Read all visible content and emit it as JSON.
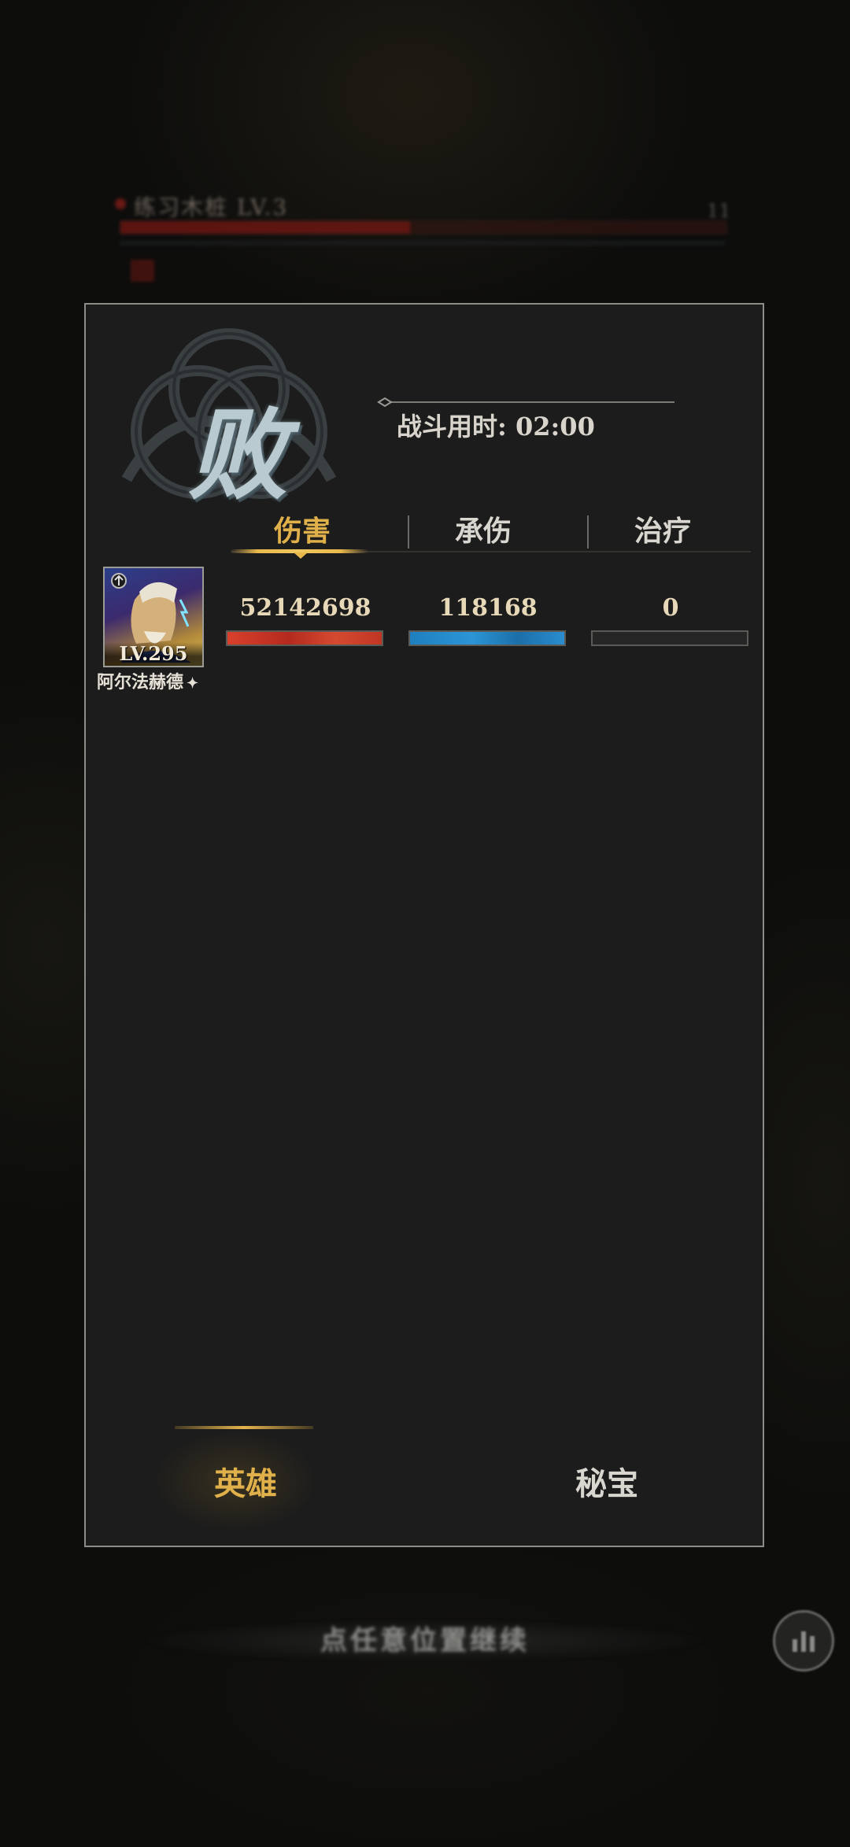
{
  "background": {
    "stage_title": "练习木桩 LV.3",
    "stage_count": "11"
  },
  "result": {
    "outcome": "败",
    "duration_label": "战斗用时: 02:00"
  },
  "stat_tabs": [
    {
      "label": "伤害",
      "active": true
    },
    {
      "label": "承伤",
      "active": false
    },
    {
      "label": "治疗",
      "active": false
    }
  ],
  "hero": {
    "name": "阿尔法赫德",
    "level": "LV.295",
    "damage": "52142698",
    "damage_taken": "118168",
    "healing": "0",
    "damage_fill": 1.0,
    "damage_taken_fill": 1.0,
    "healing_fill": 0.0
  },
  "bottom_tabs": [
    {
      "label": "英雄",
      "active": true
    },
    {
      "label": "秘宝",
      "active": false
    }
  ],
  "footer": {
    "continue_text": "点任意位置继续"
  },
  "colors": {
    "accent_gold": "#e0b04a",
    "damage_red": "#c9382a",
    "tank_blue": "#2a8ccf"
  }
}
